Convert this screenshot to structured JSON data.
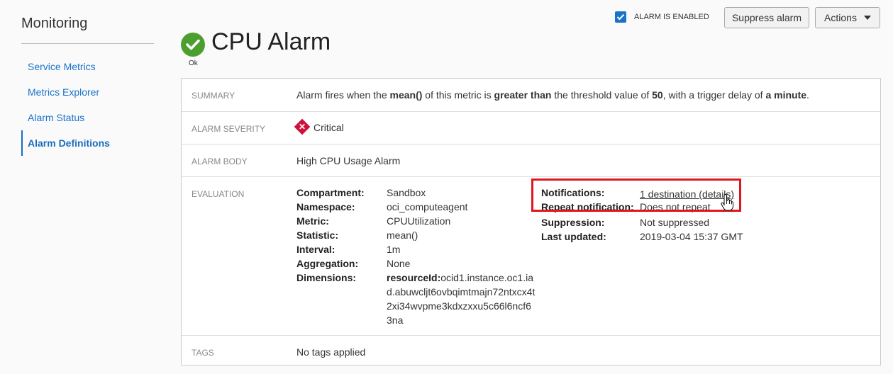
{
  "sidebar": {
    "title": "Monitoring",
    "items": [
      {
        "label": "Service Metrics"
      },
      {
        "label": "Metrics Explorer"
      },
      {
        "label": "Alarm Status"
      },
      {
        "label": "Alarm Definitions"
      }
    ]
  },
  "header": {
    "title": "CPU Alarm",
    "status": "Ok",
    "alarm_enabled_label": "ALARM IS ENABLED",
    "alarm_enabled": true,
    "suppress_label": "Suppress alarm",
    "actions_label": "Actions"
  },
  "details": {
    "summary_label": "SUMMARY",
    "summary": {
      "t1": "Alarm fires when the ",
      "b1": "mean()",
      "t2": " of this metric is ",
      "b2": "greater than",
      "t3": " the threshold value of ",
      "b3": "50",
      "t4": ", with a trigger delay of ",
      "b4": "a minute",
      "t5": "."
    },
    "severity_label": "ALARM SEVERITY",
    "severity": "Critical",
    "body_label": "ALARM BODY",
    "body": "High CPU Usage Alarm",
    "evaluation_label": "EVALUATION",
    "evaluation_left": [
      {
        "key": "Compartment:",
        "value": "Sandbox"
      },
      {
        "key": "Namespace:",
        "value": "oci_computeagent"
      },
      {
        "key": "Metric:",
        "value": "CPUUtilization"
      },
      {
        "key": "Statistic:",
        "value": "mean()"
      },
      {
        "key": "Interval:",
        "value": "1m"
      },
      {
        "key": "Aggregation:",
        "value": "None"
      },
      {
        "key": "Dimensions:",
        "value": ""
      }
    ],
    "dimensions_key": "resourceId:",
    "dimensions_value": "ocid1.instance.oc1.iad.abuwcljt6ovbqimtmajn72ntxcx4t2xi34wvpme3kdxzxxu5c66l6ncf63na",
    "evaluation_right": [
      {
        "key": "Notifications:",
        "value": "1 destination (details)"
      },
      {
        "key": "Repeat notification:",
        "value": "Does not repeat"
      },
      {
        "key": "Suppression:",
        "value": "Not suppressed"
      },
      {
        "key": "Last updated:",
        "value": "2019-03-04 15:37 GMT"
      }
    ],
    "tags_label": "TAGS",
    "tags": "No tags applied"
  },
  "colors": {
    "ok_green": "#4c9f2e",
    "critical_red": "#d0103a",
    "link_blue": "#1a73c8",
    "highlight_red": "#e0161f"
  }
}
